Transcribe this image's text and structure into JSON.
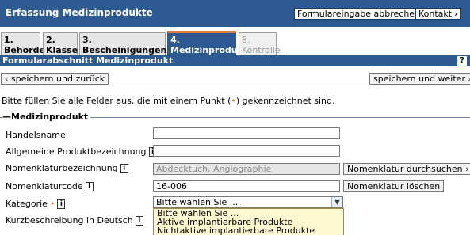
{
  "header": {
    "title": "Erfassung Medizinprodukte",
    "cancel_label": "Formulareingabe abbrechen",
    "contact_label": "Kontakt"
  },
  "tabs": [
    {
      "num": "1.",
      "label": "Behörde"
    },
    {
      "num": "2.",
      "label": "Klasse"
    },
    {
      "num": "3.",
      "label": "Bescheinigungen"
    },
    {
      "num": "4.",
      "label": "Medizinprodukt"
    },
    {
      "num": "5.",
      "label": "Kontrolle"
    }
  ],
  "section": {
    "title": "Formularabschnitt Medizinprodukt",
    "help": "?"
  },
  "actions": {
    "back_label": "speichern und zurück",
    "next_label": "speichern und weiter"
  },
  "instruction": {
    "before": "Bitte füllen Sie alle Felder aus, die mit einem Punkt (",
    "dot": "•",
    "after": ") gekennzeichnet sind."
  },
  "form": {
    "legend": "Medizinprodukt",
    "fields": {
      "handelsname": {
        "label": "Handelsname",
        "value": ""
      },
      "allgemein": {
        "label": "Allgemeine Produktbezeichnung",
        "value": ""
      },
      "nomenklaturbezeichnung": {
        "label": "Nomenklaturbezeichnung",
        "value": "Abdecktuch, Angiographie"
      },
      "nomenklaturcode": {
        "label": "Nomenklaturcode",
        "value": "16-006"
      },
      "kategorie": {
        "label": "Kategorie",
        "value": "Bitte wählen Sie ..."
      },
      "kurzbeschreibung": {
        "label": "Kurzbeschreibung in Deutsch"
      }
    },
    "nomenklatur_search_label": "Nomenklatur durchsuchen",
    "nomenklatur_delete_label": "Nomenklatur löschen",
    "kategorie_options": [
      "Bitte wählen Sie ...",
      "Aktive implantierbare Produkte",
      "Nichtaktive implantierbare Produkte"
    ]
  }
}
